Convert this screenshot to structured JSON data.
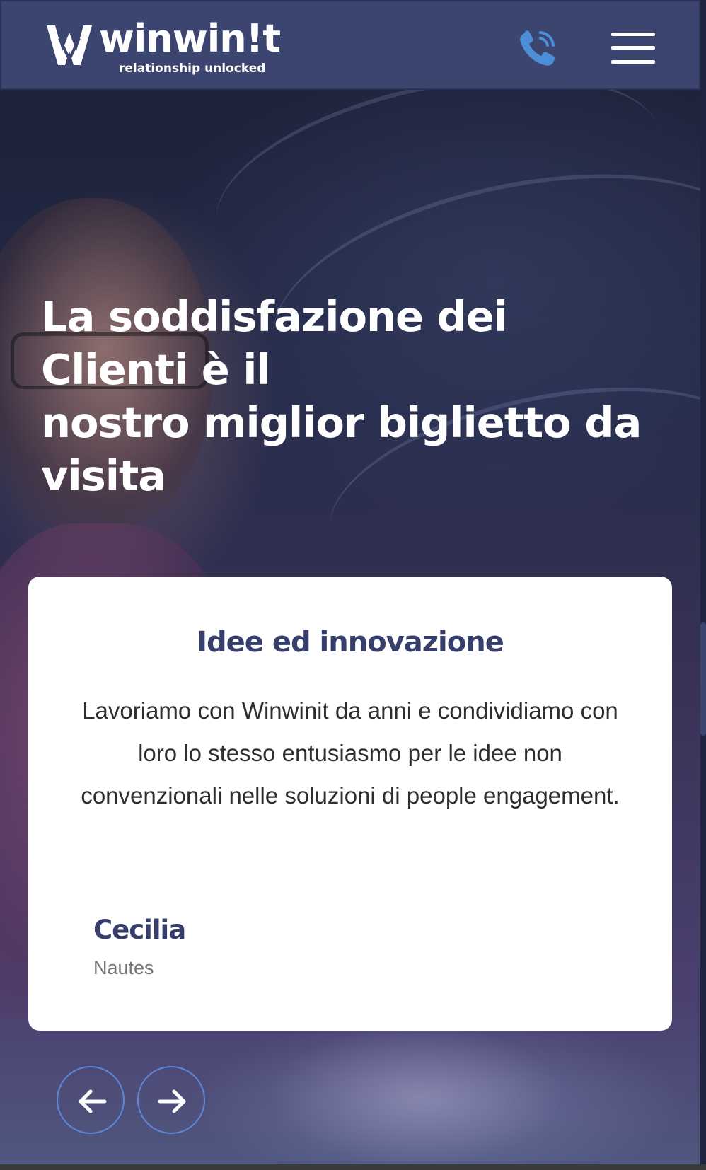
{
  "header": {
    "logo": {
      "wordmark": "winwin!t",
      "tagline": "relationship unlocked"
    },
    "phone_icon": "phone-icon",
    "menu_icon": "hamburger-menu-icon",
    "accent_color": "#4a8fd8",
    "background_color": "#3c4470"
  },
  "hero": {
    "title_lines": [
      "La soddisfazione dei Clienti è il",
      "nostro miglior biglietto da visita"
    ]
  },
  "testimonial": {
    "title": "Idee ed innovazione",
    "text": "Lavoriamo con Winwinit da anni e condividiamo con loro lo stesso entusiasmo per le idee non convenzionali nelle soluzioni di people engagement.",
    "author": "Cecilia",
    "company": "Nautes",
    "title_color": "#363e6b"
  },
  "carousel": {
    "prev_icon": "arrow-left-icon",
    "next_icon": "arrow-right-icon",
    "button_border_color": "#5f86d6"
  }
}
